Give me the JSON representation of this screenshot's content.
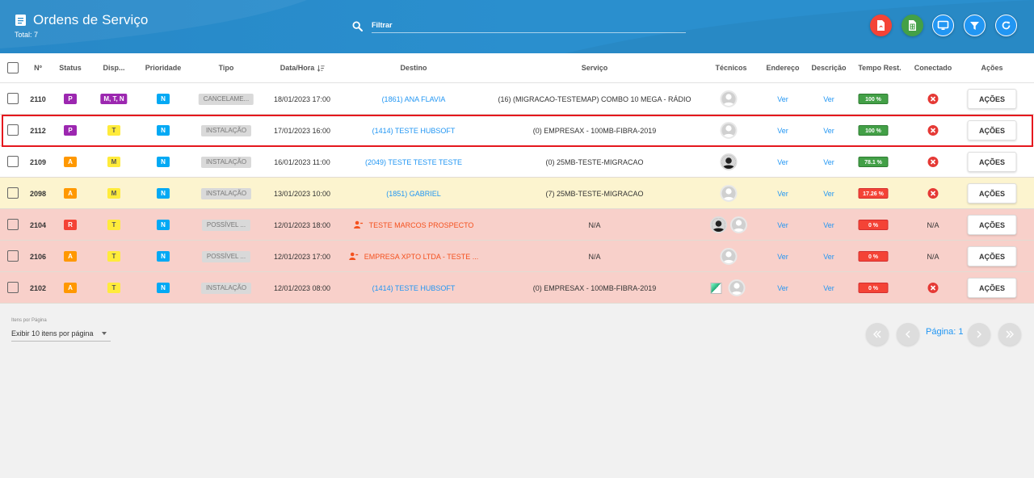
{
  "header": {
    "title": "Ordens de Serviço",
    "subtitle": "Total: 7",
    "filter_placeholder": "Filtrar",
    "buttons": [
      {
        "name": "pdf-export-button",
        "icon": "pdf-icon",
        "color": "#f44336"
      },
      {
        "name": "excel-export-button",
        "icon": "spreadsheet-icon",
        "color": "#43a047"
      },
      {
        "name": "monitor-button",
        "icon": "monitor-icon",
        "color": "#2196f3"
      },
      {
        "name": "filter-button",
        "icon": "filter-icon",
        "color": "#2196f3"
      },
      {
        "name": "refresh-button",
        "icon": "refresh-icon",
        "color": "#2196f3"
      }
    ]
  },
  "columns": {
    "num": "Nº",
    "status": "Status",
    "disp": "Disp...",
    "prioridade": "Prioridade",
    "tipo": "Tipo",
    "datahora": "Data/Hora",
    "destino": "Destino",
    "servico": "Serviço",
    "tecnicos": "Técnicos",
    "endereco": "Endereço",
    "descricao": "Descrição",
    "tempo": "Tempo Rest.",
    "conectado": "Conectado",
    "acoes": "Ações"
  },
  "rows": [
    {
      "num": "2110",
      "status": "P",
      "status_color": "purple",
      "disp": "M, T, N",
      "disp_color": "purple",
      "prioridade": "N",
      "tipo": "CANCELAME...",
      "datahora": "18/01/2023 17:00",
      "destino": "(1861) ANA FLAVIA",
      "destino_type": "client",
      "servico": "(16) (MIGRACAO-TESTEMAP) COMBO 10 MEGA - RÁDIO",
      "tecnicos": [
        "default"
      ],
      "endereco": "Ver",
      "descricao": "Ver",
      "tempo": "100 %",
      "tempo_pct": 100,
      "tempo_color": "green",
      "conectado": "x",
      "acoes": "AÇÕES",
      "bg": "#ffffff"
    },
    {
      "num": "2112",
      "status": "P",
      "status_color": "purple",
      "disp": "T",
      "disp_color": "yellow",
      "prioridade": "N",
      "tipo": "INSTALAÇÃO",
      "datahora": "17/01/2023 16:00",
      "destino": "(1414) TESTE HUBSOFT",
      "destino_type": "client",
      "servico": "(0) EMPRESAX - 100MB-FIBRA-2019",
      "tecnicos": [
        "default"
      ],
      "endereco": "Ver",
      "descricao": "Ver",
      "tempo": "100 %",
      "tempo_pct": 100,
      "tempo_color": "green",
      "conectado": "x",
      "acoes": "AÇÕES",
      "bg": "#ffffff"
    },
    {
      "num": "2109",
      "status": "A",
      "status_color": "orange",
      "disp": "M",
      "disp_color": "yellow",
      "prioridade": "N",
      "tipo": "INSTALAÇÃO",
      "datahora": "16/01/2023 11:00",
      "destino": "(2049) TESTE TESTE TESTE",
      "destino_type": "client",
      "servico": "(0) 25MB-TESTE-MIGRACAO",
      "tecnicos": [
        "photo"
      ],
      "endereco": "Ver",
      "descricao": "Ver",
      "tempo": "78.1 %",
      "tempo_pct": 78.1,
      "tempo_color": "green",
      "conectado": "x",
      "acoes": "AÇÕES",
      "bg": "#ffffff"
    },
    {
      "num": "2098",
      "status": "A",
      "status_color": "orange",
      "disp": "M",
      "disp_color": "yellow",
      "prioridade": "N",
      "tipo": "INSTALAÇÃO",
      "datahora": "13/01/2023 10:00",
      "destino": "(1851) GABRIEL",
      "destino_type": "client",
      "servico": "(7) 25MB-TESTE-MIGRACAO",
      "tecnicos": [
        "default"
      ],
      "endereco": "Ver",
      "descricao": "Ver",
      "tempo": "17.26 %",
      "tempo_pct": 17.26,
      "tempo_color": "red",
      "conectado": "x",
      "acoes": "AÇÕES",
      "bg": "#fcf4cf"
    },
    {
      "num": "2104",
      "status": "R",
      "status_color": "red",
      "disp": "T",
      "disp_color": "yellow",
      "prioridade": "N",
      "tipo": "POSSÍVEL ...",
      "datahora": "12/01/2023 18:00",
      "destino": "TESTE MARCOS PROSPECTO",
      "destino_type": "prospect",
      "servico": "N/A",
      "tecnicos": [
        "photo",
        "default"
      ],
      "endereco": "Ver",
      "descricao": "Ver",
      "tempo": "0 %",
      "tempo_pct": 0,
      "tempo_color": "red",
      "conectado": "N/A",
      "acoes": "AÇÕES",
      "bg": "#f8d0ca"
    },
    {
      "num": "2106",
      "status": "A",
      "status_color": "orange",
      "disp": "T",
      "disp_color": "yellow",
      "prioridade": "N",
      "tipo": "POSSÍVEL ...",
      "datahora": "12/01/2023 17:00",
      "destino": "EMPRESA XPTO LTDA - TESTE ...",
      "destino_type": "prospect",
      "servico": "N/A",
      "tecnicos": [
        "default"
      ],
      "endereco": "Ver",
      "descricao": "Ver",
      "tempo": "0 %",
      "tempo_pct": 0,
      "tempo_color": "red",
      "conectado": "N/A",
      "acoes": "AÇÕES",
      "bg": "#f8d0ca"
    },
    {
      "num": "2102",
      "status": "A",
      "status_color": "orange",
      "disp": "T",
      "disp_color": "yellow",
      "prioridade": "N",
      "tipo": "INSTALAÇÃO",
      "datahora": "12/01/2023 08:00",
      "destino": "(1414) TESTE HUBSOFT",
      "destino_type": "client",
      "servico": "(0) EMPRESAX - 100MB-FIBRA-2019",
      "tecnicos": [
        "broken",
        "default"
      ],
      "endereco": "Ver",
      "descricao": "Ver",
      "tempo": "0 %",
      "tempo_pct": 0,
      "tempo_color": "red",
      "conectado": "x",
      "acoes": "AÇÕES",
      "bg": "#f8d0ca"
    }
  ],
  "footer": {
    "per_page_label": "Itens por Página",
    "per_page_value": "Exibir 10 itens por página",
    "page_label": "Página: 1"
  }
}
